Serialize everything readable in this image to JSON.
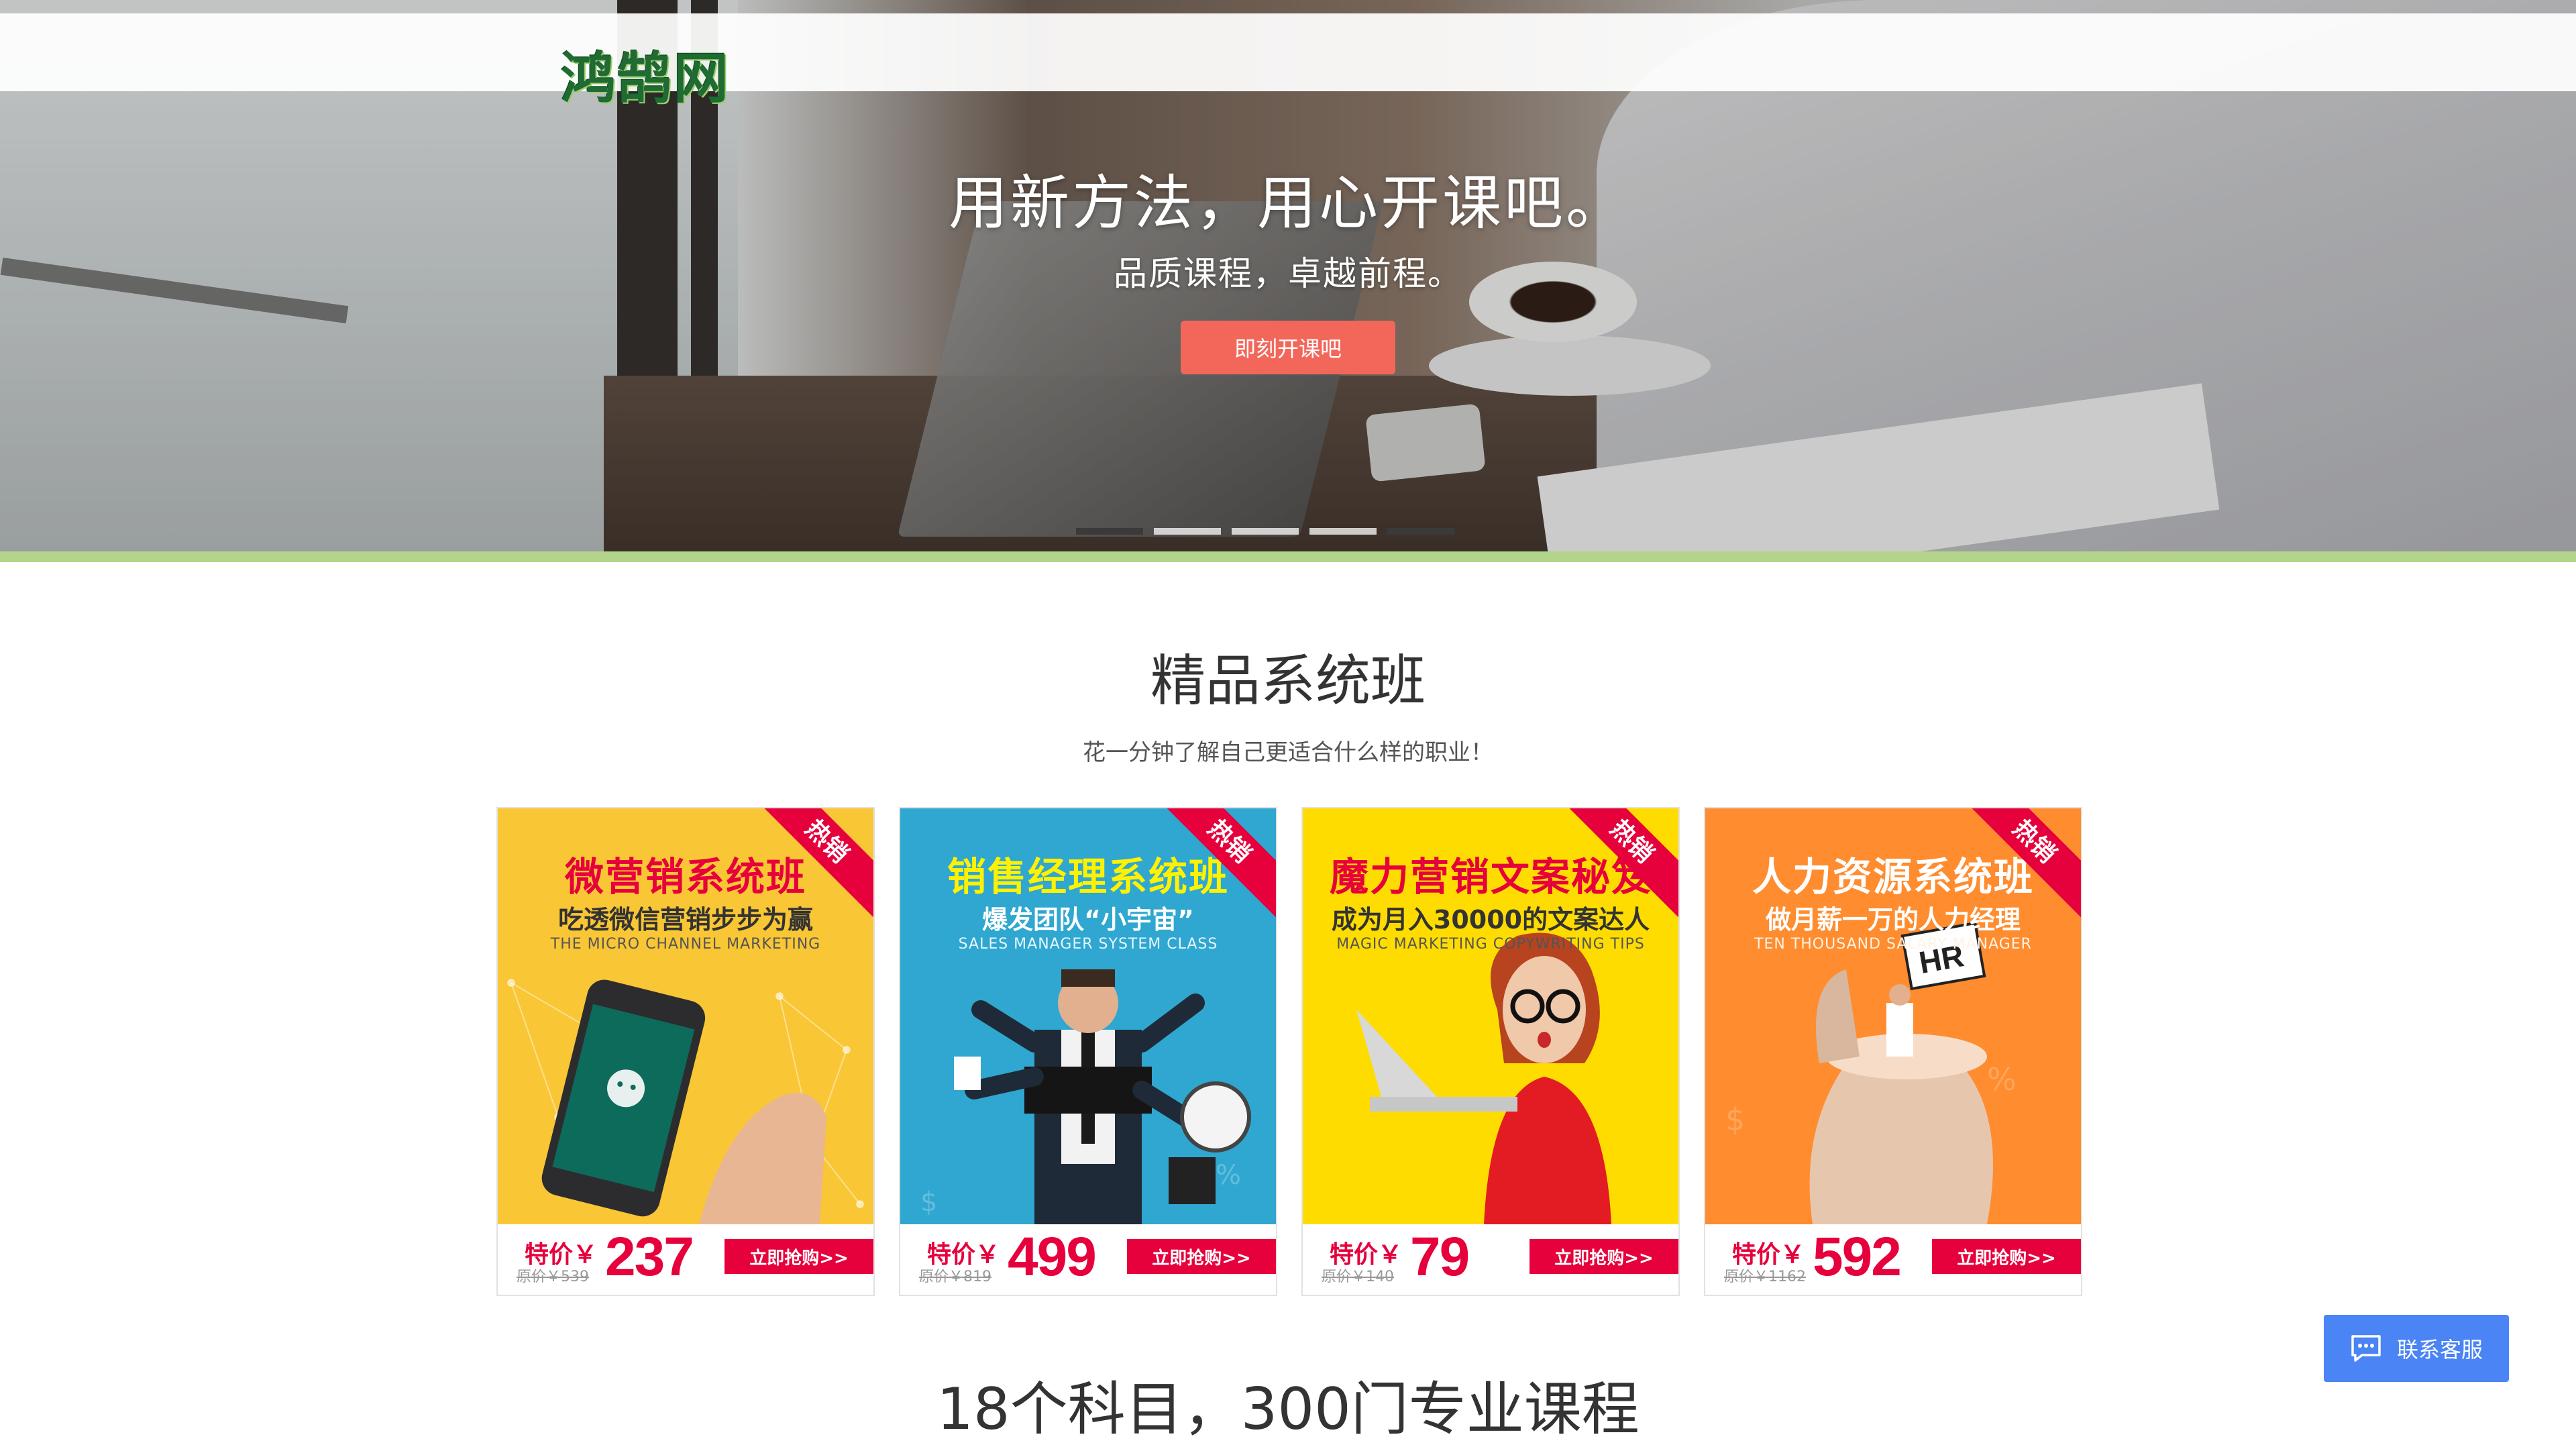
{
  "header": {
    "logo_text": "鸿鹄网"
  },
  "banner": {
    "title": "用新方法，用心开课吧。",
    "subtitle": "品质课程，卓越前程。",
    "cta_label": "即刻开课吧",
    "slides": 5,
    "active_slide": 1
  },
  "section1": {
    "title": "精品系统班",
    "subtitle": "花一分钟了解自己更适合什么样的职业！",
    "cards": [
      {
        "title": "微营销系统班",
        "subtitle": "吃透微信营销步步为赢",
        "english": "THE MICRO CHANNEL MARKETING",
        "badge": "热销",
        "price_prefix": "特价￥",
        "price": "237",
        "original_price": "原价￥539",
        "buy_label": "立即抢购>>",
        "bg_color": "#f9c635"
      },
      {
        "title": "销售经理系统班",
        "subtitle": "爆发团队“小宇宙”",
        "english": "SALES MANAGER SYSTEM CLASS",
        "badge": "热销",
        "price_prefix": "特价￥",
        "price": "499",
        "original_price": "原价￥819",
        "buy_label": "立即抢购>>",
        "bg_color": "#2fa7d0"
      },
      {
        "title": "魔力营销文案秘笈",
        "subtitle": "成为月入30000的文案达人",
        "english": "MAGIC MARKETING COPYWRITING TIPS",
        "badge": "热销",
        "price_prefix": "特价￥",
        "price": "79",
        "original_price": "原价￥140",
        "buy_label": "立即抢购>>",
        "bg_color": "#ffdc00"
      },
      {
        "title": "人力资源系统班",
        "subtitle": "做月薪一万的人力经理",
        "english": "TEN THOUSAND SALARY MANAGER",
        "badge": "热销",
        "price_prefix": "特价￥",
        "price": "592",
        "original_price": "原价￥1162",
        "buy_label": "立即抢购>>",
        "bg_color": "#ff8c2e",
        "sign_text": "HR"
      }
    ]
  },
  "section2": {
    "title": "18个科目，300门专业课程"
  },
  "contact": {
    "label": "联系客服",
    "icon": "chat-icon",
    "color": "#4a84f5"
  }
}
